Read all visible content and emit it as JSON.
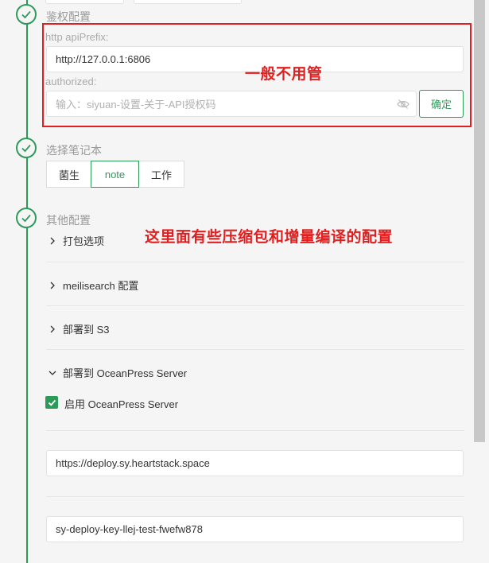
{
  "steps": {
    "auth": {
      "title": "鉴权配置"
    },
    "notebook": {
      "title": "选择笔记本"
    },
    "other": {
      "title": "其他配置"
    }
  },
  "auth": {
    "api_prefix_label": "http apiPrefix:",
    "api_prefix_value": "http://127.0.0.1:6806",
    "authorized_label": "authorized:",
    "authorized_placeholder": "输入：siyuan-设置-关于-API授权码",
    "confirm_label": "确定"
  },
  "notebooks": {
    "options": [
      "菌生",
      "note",
      "工作"
    ],
    "selected": "note"
  },
  "other": {
    "sections": [
      {
        "label": "打包选项",
        "expanded": false
      },
      {
        "label": "meilisearch 配置",
        "expanded": false
      },
      {
        "label": "部署到 S3",
        "expanded": false
      },
      {
        "label": "部署到 OceanPress Server",
        "expanded": true
      }
    ],
    "enable_label": "启用 OceanPress Server",
    "enable_checked": true,
    "server_url": "https://deploy.sy.heartstack.space",
    "deploy_key": "sy-deploy-key-llej-test-fwefw878"
  },
  "annotations": {
    "auth_note": "一般不用管",
    "other_note": "这里面有些压缩包和增量编译的配置"
  },
  "colors": {
    "accent": "#2e9a5a",
    "annotation": "#e02020"
  },
  "icons": [
    "check-icon",
    "chevron-right-icon",
    "chevron-down-icon",
    "eye-off-icon"
  ]
}
